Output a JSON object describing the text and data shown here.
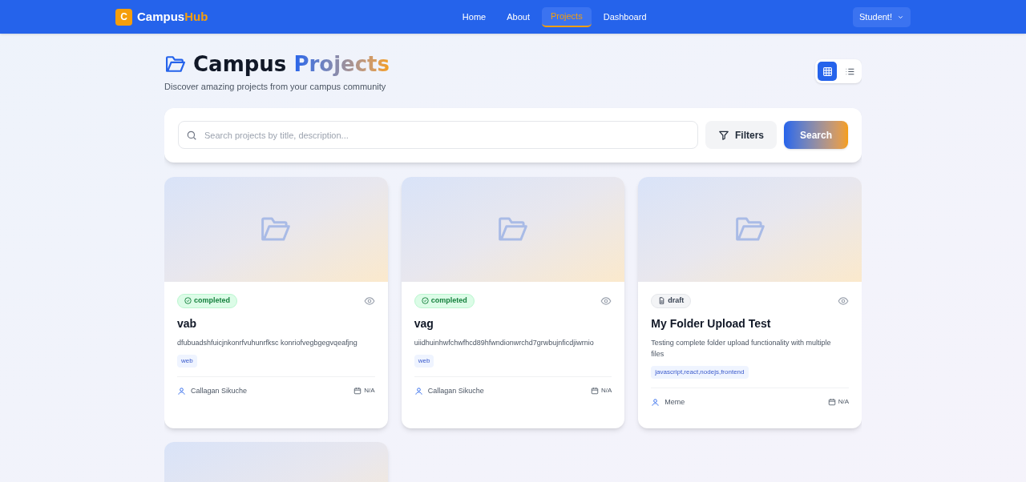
{
  "brand": {
    "mark": "C",
    "name": "Campus",
    "name_highlight": "Hub"
  },
  "nav": [
    {
      "label": "Home",
      "selected": false
    },
    {
      "label": "About",
      "selected": false
    },
    {
      "label": "Projects",
      "selected": true
    },
    {
      "label": "Dashboard",
      "selected": false
    }
  ],
  "user_menu": {
    "label": "Student!"
  },
  "header": {
    "title": "Campus",
    "title_highlight": "Projects",
    "subtitle": "Discover amazing projects from your campus community"
  },
  "view_toggle": [
    {
      "kind": "grid",
      "selected": true
    },
    {
      "kind": "list",
      "selected": false
    }
  ],
  "search": {
    "placeholder": "Search projects by title, description...",
    "filters_button": "Filters",
    "search_button": "Search"
  },
  "projects": [
    {
      "kind": "card",
      "status": "completed",
      "title": "vab",
      "description": "dfubuadshfuicjnkonrfvuhunrfksc konriofvegbgegvqeafjng",
      "tags": [
        "web"
      ],
      "author": "Callagan Sikuche",
      "date": "N/A"
    },
    {
      "kind": "card",
      "status": "completed",
      "title": "vag",
      "description": "uiidhuinhwfchwfhcd89hfwndionwrchd7grwbujnficdjiwrnio",
      "tags": [
        "web"
      ],
      "author": "Callagan Sikuche",
      "date": "N/A"
    },
    {
      "kind": "card",
      "status": "draft",
      "title": "My Folder Upload Test",
      "description": "Testing complete folder upload functionality with multiple files",
      "tags": [
        "javascript,react,nodejs,frontend"
      ],
      "author": "Meme",
      "date": "N/A"
    },
    {
      "kind": "cover_only"
    }
  ]
}
